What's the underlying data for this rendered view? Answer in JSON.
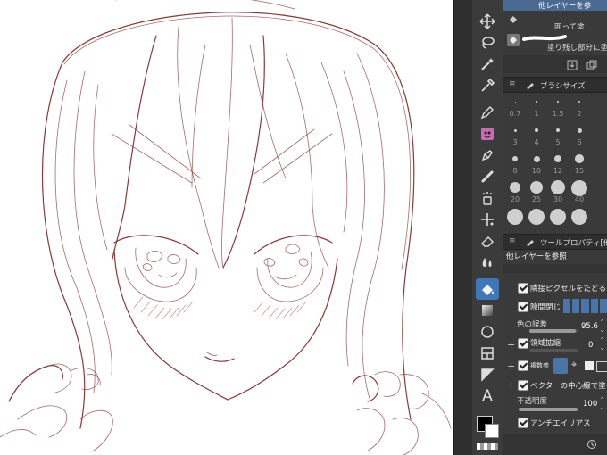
{
  "layer_panel": {
    "ref_text": "他レイヤーを参",
    "tool_enclose": "囲って塗",
    "tool_fill_leftover": "塗り残し部分に塗"
  },
  "brush_size_panel": {
    "title": "ブラシサイズ",
    "rows": [
      [
        "0.7",
        "1",
        "1.5",
        "2"
      ],
      [
        "3",
        "4",
        "5",
        "6"
      ],
      [
        "8",
        "10",
        "12",
        "15"
      ],
      [
        "20",
        "25",
        "30",
        "40"
      ],
      [
        "",
        "",
        "",
        ""
      ]
    ]
  },
  "tool_property": {
    "title": "ツールプロパティ[他",
    "subtool_name": "他レイヤーを参照",
    "follow_adjacent": "隣接ピクセルをたどる",
    "close_gap": "隙間閉じ",
    "color_margin_label": "色の誤差",
    "color_margin_value": "95.6",
    "color_margin_fraction": 0.956,
    "area_scaling_label": "領域拡縮",
    "area_scaling_value": "0",
    "multi_ref_label": "複数参",
    "vector_center": "ベクターの中心線で塗り止ま",
    "opacity_label": "不透明度",
    "opacity_value": "100",
    "opacity_fraction": 1.0,
    "antialias": "アンチエイリアス"
  },
  "colors": {
    "main_color": "#000000",
    "sub_color": "#ffffff",
    "active_tool_bg": "#3f78b8",
    "sketch_stroke": "#8a3a36"
  }
}
